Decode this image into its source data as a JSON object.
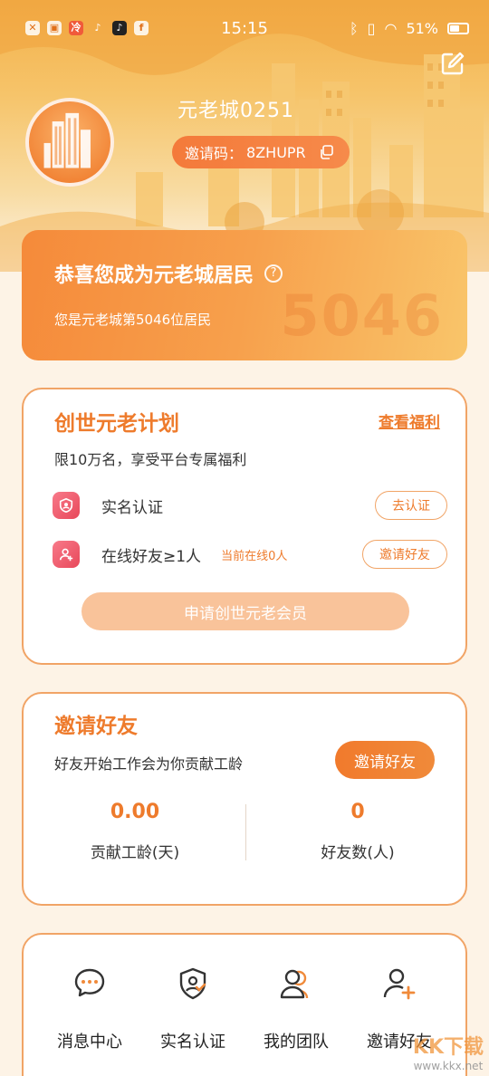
{
  "status_bar": {
    "time": "15:15",
    "battery": "51%",
    "app_icons": [
      "notification-app-icon",
      "gallery-app-icon",
      "red-app-icon",
      "tiktok-icon",
      "tiktok-lite-icon",
      "facebook-icon"
    ]
  },
  "profile": {
    "username": "元老城0251",
    "invite_label": "邀请码：",
    "invite_code": "8ZHUPR"
  },
  "resident": {
    "title": "恭喜您成为元老城居民",
    "help_glyph": "?",
    "subtitle": "您是元老城第5046位居民",
    "number": "5046"
  },
  "plan": {
    "title": "创世元老计划",
    "view_link": "查看福利",
    "description": "限10万名，享受平台专属福利",
    "tasks": [
      {
        "label": "实名认证",
        "note": "",
        "button": "去认证"
      },
      {
        "label": "在线好友≥1人",
        "note": "当前在线0人",
        "button": "邀请好友"
      }
    ],
    "apply_button": "申请创世元老会员"
  },
  "invite": {
    "title": "邀请好友",
    "description": "好友开始工作会为你贡献工龄",
    "button": "邀请好友",
    "stats": [
      {
        "value": "0.00",
        "label": "贡献工龄(天)"
      },
      {
        "value": "0",
        "label": "好友数(人)"
      }
    ]
  },
  "tools": [
    {
      "icon": "message-icon",
      "label": "消息中心"
    },
    {
      "icon": "verify-shield-icon",
      "label": "实名认证"
    },
    {
      "icon": "team-icon",
      "label": "我的团队"
    },
    {
      "icon": "add-friend-icon",
      "label": "邀请好友"
    }
  ],
  "watermark": {
    "text": "KK下载",
    "url": "www.kkx.net"
  },
  "colors": {
    "accent": "#ee7b2c",
    "card_border": "#f1a466",
    "disabled_button": "#f9c39a"
  }
}
